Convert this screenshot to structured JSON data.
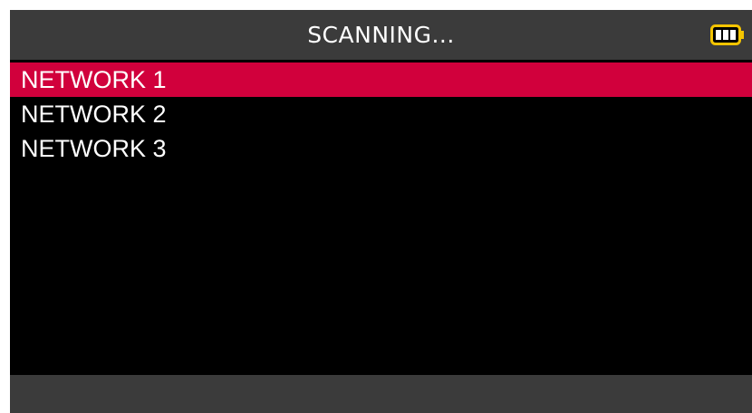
{
  "header": {
    "title": "SCANNING...",
    "battery_icon": "battery-full-icon"
  },
  "networks": [
    {
      "label": "NETWORK 1",
      "selected": true
    },
    {
      "label": "NETWORK 2",
      "selected": false
    },
    {
      "label": "NETWORK 3",
      "selected": false
    }
  ],
  "colors": {
    "header_bg": "#3b3b3b",
    "selection": "#d1003c",
    "battery": "#f4c400"
  }
}
